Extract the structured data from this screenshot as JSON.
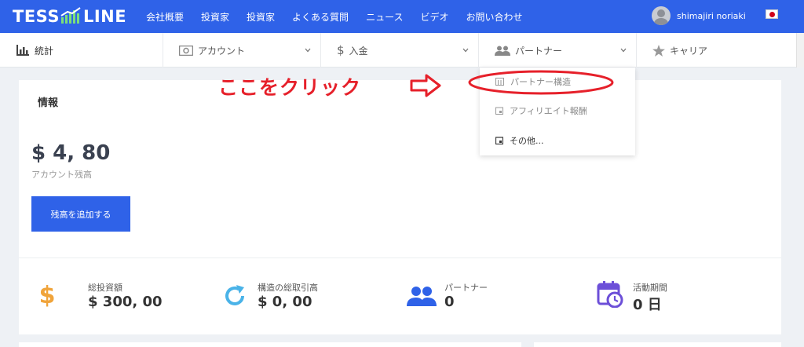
{
  "brand": {
    "logo_left": "TESS",
    "logo_right": "LINE"
  },
  "nav": {
    "items": [
      "会社概要",
      "投資家",
      "投資家",
      "よくある質問",
      "ニュース",
      "ビデオ",
      "お問い合わせ"
    ]
  },
  "user": {
    "name": "shimajiri noriaki"
  },
  "tabs": {
    "stats": "統計",
    "account": "アカウント",
    "deposit": "入金",
    "partner": "パートナー",
    "career": "キャリア"
  },
  "dropdown": {
    "items": [
      "パートナー構造",
      "アフィリエイト報酬",
      "その他..."
    ]
  },
  "annotation": {
    "text": "ここをクリック"
  },
  "card": {
    "title": "情報",
    "balance": "$ 4, 80",
    "balance_label": "アカウント残高",
    "add_button": "残高を追加する"
  },
  "stats": [
    {
      "label": "総投資額",
      "value": "$ 300, 00",
      "icon": "dollar-icon",
      "color": "#f0a43b"
    },
    {
      "label": "構造の総取引高",
      "value": "$ 0, 00",
      "icon": "refresh-icon",
      "color": "#4ab3e8"
    },
    {
      "label": "パートナー",
      "value": "0",
      "icon": "people-icon",
      "color": "#2f62e8"
    },
    {
      "label": "活動期間",
      "value": "0 日",
      "icon": "calendar-clock-icon",
      "color": "#6c4fd8"
    }
  ],
  "colors": {
    "primary": "#2f62e8",
    "annotation": "#e6202a"
  }
}
